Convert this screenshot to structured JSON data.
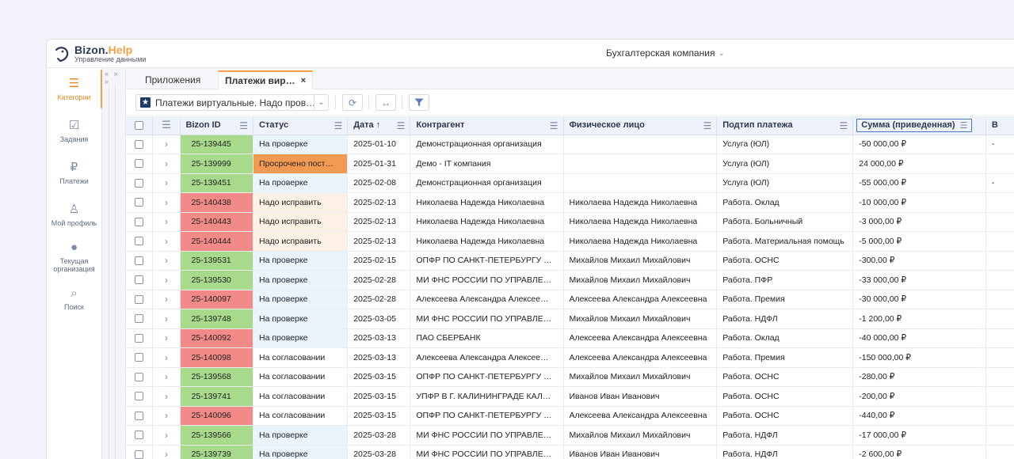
{
  "brand": {
    "name_main": "Bizon.",
    "name_accent": "Help",
    "subtitle": "Управление данными"
  },
  "header": {
    "company": "Бухгалтерская компания",
    "company_chevron": "chevron-down-icon"
  },
  "panel_toggle": "« » »",
  "sidebar": {
    "items": [
      {
        "label": "Категории",
        "icon": "menu-icon",
        "glyph": "☰",
        "active": true
      },
      {
        "label": "Задания",
        "icon": "tasks-icon",
        "glyph": "☑",
        "active": false
      },
      {
        "label": "Платежи",
        "icon": "ruble-icon",
        "glyph": "₽",
        "active": false
      },
      {
        "label": "Мой профиль",
        "icon": "user-icon",
        "glyph": "♙",
        "active": false
      },
      {
        "label": "Текущая организация",
        "icon": "location-pin-icon",
        "glyph": "●",
        "active": false
      },
      {
        "label": "Поиск",
        "icon": "search-icon",
        "glyph": "⌕",
        "active": false
      }
    ]
  },
  "tabs": [
    {
      "label": "Приложения",
      "active": false
    },
    {
      "label": "Платежи вир…",
      "active": true,
      "close": "×"
    }
  ],
  "toolbar": {
    "filter_value": "Платежи виртуальные. Надо пров…",
    "filter_icon": "star-icon",
    "refresh_icon": "refresh-icon",
    "resize_icon": "arrows-horizontal-icon",
    "filter_button_icon": "filter-icon"
  },
  "columns": {
    "id": "Bizon ID",
    "status": "Статус",
    "date": "Дата",
    "counterparty": "Контрагент",
    "person": "Физическое лицо",
    "subtype": "Подтип платежа",
    "amount": "Сумма (приведенная)",
    "next": "В"
  },
  "colors": {
    "accent": "#f08a24",
    "id_green": "#a8da8c",
    "id_red": "#f28a88",
    "status_overdue": "#f39a52"
  },
  "rows": [
    {
      "id": "25-139445",
      "id_color": "green",
      "status": "На проверке",
      "status_type": "check",
      "date": "2025-01-10",
      "counterparty": "Демонстрационная организация",
      "person": "",
      "subtype": "Услуга (ЮЛ)",
      "amount": "-50 000,00 ₽",
      "tail": "-"
    },
    {
      "id": "25-139999",
      "id_color": "green",
      "status": "Просрочено пост…",
      "status_type": "overdue",
      "date": "2025-01-31",
      "counterparty": "Демо - IT компания",
      "person": "",
      "subtype": "Услуга (ЮЛ)",
      "amount": "24 000,00 ₽",
      "tail": ""
    },
    {
      "id": "25-139451",
      "id_color": "green",
      "status": "На проверке",
      "status_type": "check",
      "date": "2025-02-08",
      "counterparty": "Демонстрационная организация",
      "person": "",
      "subtype": "Услуга (ЮЛ)",
      "amount": "-55 000,00 ₽",
      "tail": "-"
    },
    {
      "id": "25-140438",
      "id_color": "red",
      "status": "Надо исправить",
      "status_type": "fix",
      "date": "2025-02-13",
      "counterparty": "Николаева Надежда Николаевна",
      "person": "Николаева Надежда Николаевна",
      "subtype": "Работа. Оклад",
      "amount": "-10 000,00 ₽",
      "tail": ""
    },
    {
      "id": "25-140443",
      "id_color": "red",
      "status": "Надо исправить",
      "status_type": "fix",
      "date": "2025-02-13",
      "counterparty": "Николаева Надежда Николаевна",
      "person": "Николаева Надежда Николаевна",
      "subtype": "Работа. Больничный",
      "amount": "-3 000,00 ₽",
      "tail": ""
    },
    {
      "id": "25-140444",
      "id_color": "red",
      "status": "Надо исправить",
      "status_type": "fix",
      "date": "2025-02-13",
      "counterparty": "Николаева Надежда Николаевна",
      "person": "Николаева Надежда Николаевна",
      "subtype": "Работа. Материальная помощь",
      "amount": "-5 000,00 ₽",
      "tail": ""
    },
    {
      "id": "25-139531",
      "id_color": "green",
      "status": "На проверке",
      "status_type": "check",
      "date": "2025-02-15",
      "counterparty": "ОПФР ПО САНКТ-ПЕТЕРБУРГУ …",
      "person": "Михайлов Михаил Михайлович",
      "subtype": "Работа. ОСНС",
      "amount": "-300,00 ₽",
      "tail": ""
    },
    {
      "id": "25-139530",
      "id_color": "green",
      "status": "На проверке",
      "status_type": "check",
      "date": "2025-02-28",
      "counterparty": "МИ ФНС РОССИИ ПО УПРАВЛЕ…",
      "person": "Михайлов Михаил Михайлович",
      "subtype": "Работа. ПФР",
      "amount": "-33 000,00 ₽",
      "tail": ""
    },
    {
      "id": "25-140097",
      "id_color": "red",
      "status": "На проверке",
      "status_type": "check",
      "date": "2025-02-28",
      "counterparty": "Алексеева Александра Алексее…",
      "person": "Алексеева Александра Алексеевна",
      "subtype": "Работа. Премия",
      "amount": "-30 000,00 ₽",
      "tail": ""
    },
    {
      "id": "25-139748",
      "id_color": "green",
      "status": "На проверке",
      "status_type": "check",
      "date": "2025-03-05",
      "counterparty": "МИ ФНС РОССИИ ПО УПРАВЛЕ…",
      "person": "Михайлов Михаил Михайлович",
      "subtype": "Работа. НДФЛ",
      "amount": "-1 200,00 ₽",
      "tail": ""
    },
    {
      "id": "25-140092",
      "id_color": "red",
      "status": "На проверке",
      "status_type": "check",
      "date": "2025-03-13",
      "counterparty": "ПАО СБЕРБАНК",
      "person": "Алексеева Александра Алексеевна",
      "subtype": "Работа. Оклад",
      "amount": "-40 000,00 ₽",
      "tail": ""
    },
    {
      "id": "25-140098",
      "id_color": "red",
      "status": "На согласовании",
      "status_type": "approval",
      "date": "2025-03-13",
      "counterparty": "Алексеева Александра Алексее…",
      "person": "Алексеева Александра Алексеевна",
      "subtype": "Работа. Премия",
      "amount": "-150 000,00 ₽",
      "tail": ""
    },
    {
      "id": "25-139568",
      "id_color": "green",
      "status": "На согласовании",
      "status_type": "approval",
      "date": "2025-03-15",
      "counterparty": "ОПФР ПО САНКТ-ПЕТЕРБУРГУ …",
      "person": "Михайлов Михаил Михайлович",
      "subtype": "Работа. ОСНС",
      "amount": "-280,00 ₽",
      "tail": ""
    },
    {
      "id": "25-139741",
      "id_color": "green",
      "status": "На согласовании",
      "status_type": "approval",
      "date": "2025-03-15",
      "counterparty": "УПФР В Г. КАЛИНИНГРАДЕ КАЛ…",
      "person": "Иванов Иван Иванович",
      "subtype": "Работа. ОСНС",
      "amount": "-200,00 ₽",
      "tail": ""
    },
    {
      "id": "25-140096",
      "id_color": "red",
      "status": "На согласовании",
      "status_type": "approval",
      "date": "2025-03-15",
      "counterparty": "ОПФР ПО САНКТ-ПЕТЕРБУРГУ …",
      "person": "Алексеева Александра Алексеевна",
      "subtype": "Работа. ОСНС",
      "amount": "-440,00 ₽",
      "tail": ""
    },
    {
      "id": "25-139566",
      "id_color": "green",
      "status": "На проверке",
      "status_type": "check",
      "date": "2025-03-28",
      "counterparty": "МИ ФНС РОССИИ ПО УПРАВЛЕ…",
      "person": "Михайлов Михаил Михайлович",
      "subtype": "Работа. НДФЛ",
      "amount": "-17 000,00 ₽",
      "tail": ""
    },
    {
      "id": "25-139739",
      "id_color": "green",
      "status": "На проверке",
      "status_type": "check",
      "date": "2025-03-28",
      "counterparty": "МИ ФНС РОССИИ ПО УПРАВЛЕ…",
      "person": "Иванов Иван Иванович",
      "subtype": "Работа. НДФЛ",
      "amount": "-2 600,00 ₽",
      "tail": ""
    }
  ]
}
